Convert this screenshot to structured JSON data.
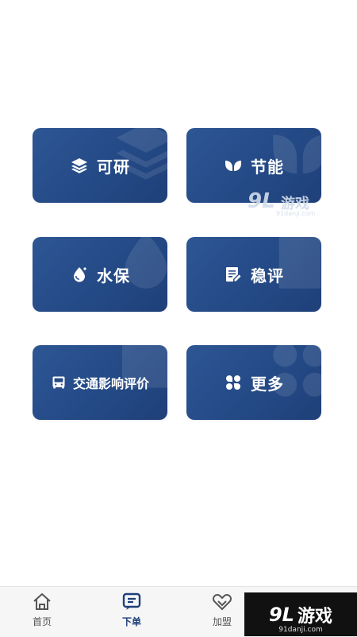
{
  "grid": {
    "items": [
      {
        "label": "可研",
        "icon": "layers-icon"
      },
      {
        "label": "节能",
        "icon": "leaves-icon"
      },
      {
        "label": "水保",
        "icon": "water-drop-icon"
      },
      {
        "label": "稳评",
        "icon": "edit-document-icon"
      },
      {
        "label": "交通影响评价",
        "icon": "bus-icon"
      },
      {
        "label": "更多",
        "icon": "grid-more-icon"
      }
    ]
  },
  "watermark": {
    "logo": "9L",
    "name": "游戏",
    "url": "91danji.com"
  },
  "tabbar": {
    "tabs": [
      {
        "label": "首页",
        "icon": "home-icon"
      },
      {
        "label": "下单",
        "icon": "order-icon",
        "active": true
      },
      {
        "label": "加盟",
        "icon": "handshake-icon"
      }
    ]
  },
  "brand": {
    "logo": "9L",
    "name": "游戏",
    "url": "91danji.com"
  },
  "colors": {
    "card": "#244a86",
    "active_tab": "#1f3f7a"
  }
}
